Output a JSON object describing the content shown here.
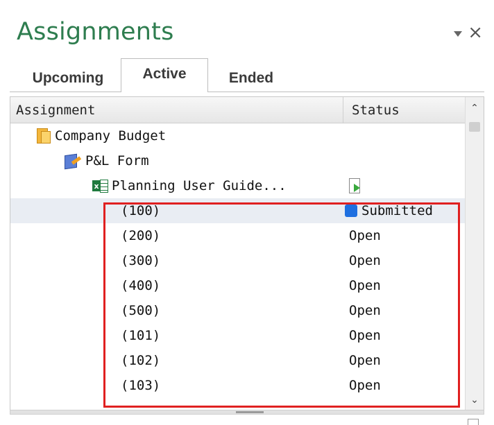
{
  "pane": {
    "title": "Assignments"
  },
  "tabs": [
    {
      "label": "Upcoming",
      "active": false
    },
    {
      "label": "Active",
      "active": true
    },
    {
      "label": "Ended",
      "active": false
    }
  ],
  "columns": {
    "assignment": "Assignment",
    "status": "Status"
  },
  "tree": [
    {
      "label": "Company Budget",
      "icon": "folder-icon",
      "status": ""
    },
    {
      "label": "P&L Form",
      "icon": "form-icon",
      "status": ""
    },
    {
      "label": "Planning User Guide...",
      "icon": "excel-icon",
      "status": "",
      "status_icon": "document-arrow-icon"
    },
    {
      "label": "(100)",
      "status": "Submitted",
      "status_icon": "submitted-status-icon",
      "selected": true
    },
    {
      "label": "(200)",
      "status": "Open"
    },
    {
      "label": "(300)",
      "status": "Open"
    },
    {
      "label": "(400)",
      "status": "Open"
    },
    {
      "label": "(500)",
      "status": "Open"
    },
    {
      "label": "(101)",
      "status": "Open"
    },
    {
      "label": "(102)",
      "status": "Open"
    },
    {
      "label": "(103)",
      "status": "Open"
    }
  ],
  "colors": {
    "title": "#2e7d4f",
    "highlight": "#e02020",
    "submitted": "#1e6fe0",
    "selected_row": "#e9edf3"
  }
}
